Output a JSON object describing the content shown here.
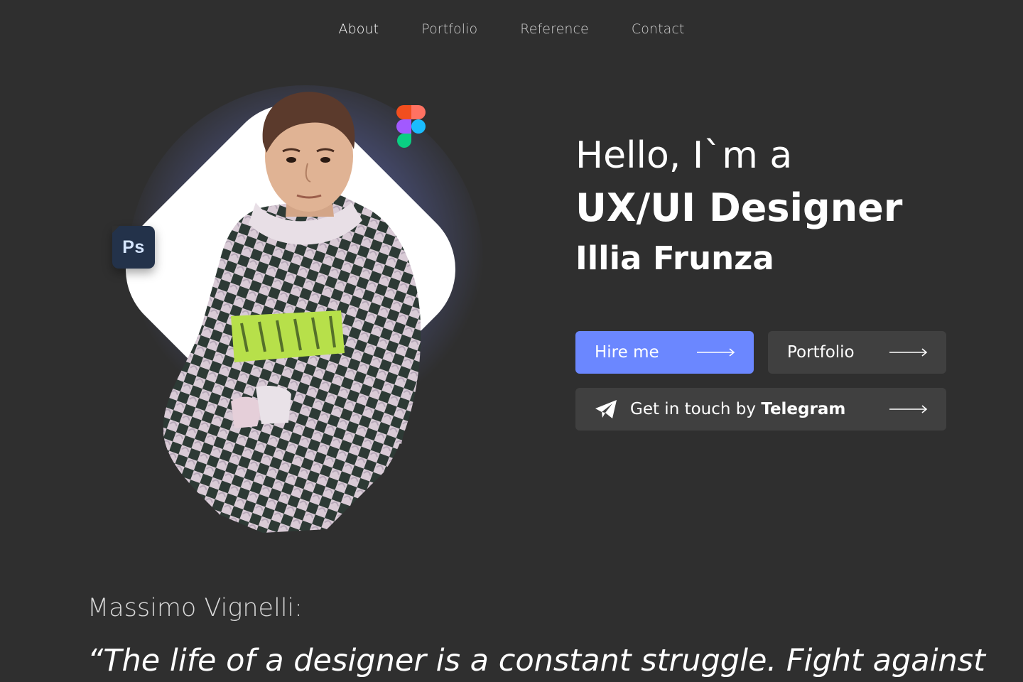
{
  "nav": {
    "items": [
      {
        "label": "About",
        "active": true
      },
      {
        "label": "Portfolio",
        "active": false
      },
      {
        "label": "Reference",
        "active": false
      },
      {
        "label": "Contact",
        "active": false
      }
    ]
  },
  "hero": {
    "greeting": "Hello, I`m a",
    "role": "UX/UI Designer",
    "name": "Illia Frunza",
    "badges": {
      "photoshop_label": "Ps"
    },
    "buttons": {
      "hire_label": "Hire me",
      "portfolio_label": "Portfolio",
      "telegram_prefix": "Get in touch by",
      "telegram_bold": "Telegram"
    }
  },
  "quote": {
    "author": "Massimo Vignelli:",
    "text": "“The life of a designer is a constant struggle. Fight against"
  },
  "colors": {
    "background": "#2f2f2f",
    "accent": "#6b87ff",
    "button_dark": "#404040",
    "glow": "#7680d2"
  },
  "icons": [
    "figma-icon",
    "photoshop-icon",
    "telegram-icon",
    "arrow-right-icon"
  ]
}
